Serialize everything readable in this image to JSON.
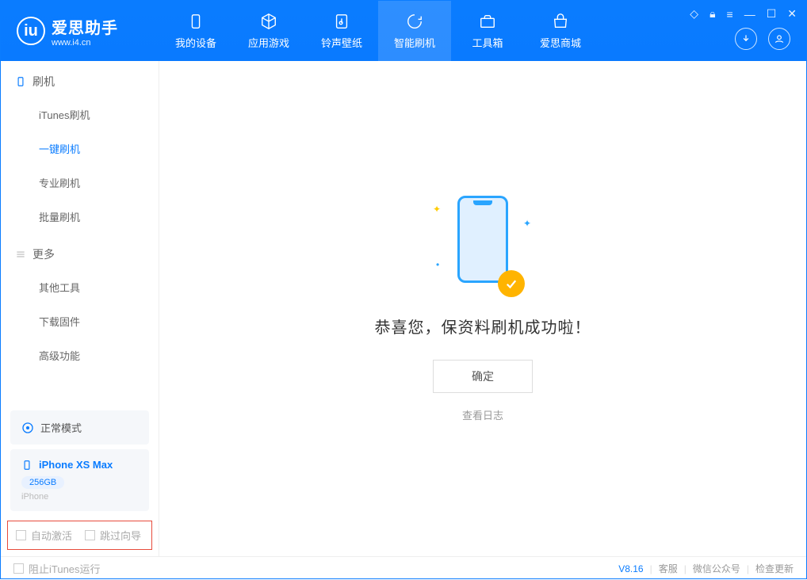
{
  "app": {
    "title": "爱思助手",
    "url": "www.i4.cn"
  },
  "nav": {
    "tabs": [
      {
        "label": "我的设备"
      },
      {
        "label": "应用游戏"
      },
      {
        "label": "铃声壁纸"
      },
      {
        "label": "智能刷机"
      },
      {
        "label": "工具箱"
      },
      {
        "label": "爱思商城"
      }
    ]
  },
  "sidebar": {
    "group1_title": "刷机",
    "group1_items": [
      {
        "label": "iTunes刷机"
      },
      {
        "label": "一键刷机"
      },
      {
        "label": "专业刷机"
      },
      {
        "label": "批量刷机"
      }
    ],
    "group2_title": "更多",
    "group2_items": [
      {
        "label": "其他工具"
      },
      {
        "label": "下载固件"
      },
      {
        "label": "高级功能"
      }
    ],
    "mode_label": "正常模式",
    "device": {
      "name": "iPhone XS Max",
      "storage": "256GB",
      "type": "iPhone"
    },
    "checkbox1": "自动激活",
    "checkbox2": "跳过向导"
  },
  "main": {
    "success_message": "恭喜您，保资料刷机成功啦！",
    "ok_button": "确定",
    "view_log": "查看日志"
  },
  "footer": {
    "block_itunes": "阻止iTunes运行",
    "version": "V8.16",
    "links": [
      "客服",
      "微信公众号",
      "检查更新"
    ]
  }
}
